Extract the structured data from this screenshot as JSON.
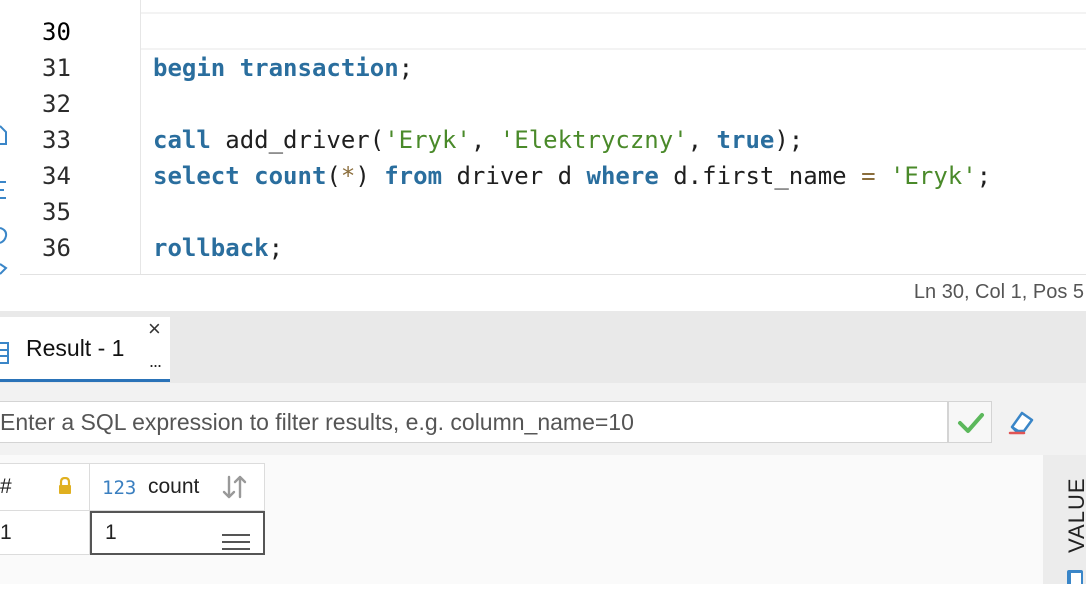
{
  "editor": {
    "lines": [
      {
        "number": "30",
        "tokens": []
      },
      {
        "number": "31",
        "tokens": [
          {
            "t": "kw",
            "v": "begin"
          },
          {
            "t": "pl",
            "v": " "
          },
          {
            "t": "kw",
            "v": "transaction"
          },
          {
            "t": "pl",
            "v": ";"
          }
        ]
      },
      {
        "number": "32",
        "tokens": []
      },
      {
        "number": "33",
        "tokens": [
          {
            "t": "kw",
            "v": "call"
          },
          {
            "t": "pl",
            "v": " add_driver("
          },
          {
            "t": "str",
            "v": "'Eryk'"
          },
          {
            "t": "pl",
            "v": ", "
          },
          {
            "t": "str",
            "v": "'Elektryczny'"
          },
          {
            "t": "pl",
            "v": ", "
          },
          {
            "t": "kw",
            "v": "true"
          },
          {
            "t": "pl",
            "v": ");"
          }
        ]
      },
      {
        "number": "34",
        "tokens": [
          {
            "t": "kw",
            "v": "select"
          },
          {
            "t": "pl",
            "v": " "
          },
          {
            "t": "kw",
            "v": "count"
          },
          {
            "t": "pl",
            "v": "("
          },
          {
            "t": "op",
            "v": "*"
          },
          {
            "t": "pl",
            "v": ") "
          },
          {
            "t": "kw",
            "v": "from"
          },
          {
            "t": "pl",
            "v": " driver d "
          },
          {
            "t": "kw",
            "v": "where"
          },
          {
            "t": "pl",
            "v": " d.first_name "
          },
          {
            "t": "op",
            "v": "="
          },
          {
            "t": "pl",
            "v": " "
          },
          {
            "t": "str",
            "v": "'Eryk'"
          },
          {
            "t": "pl",
            "v": ";"
          }
        ]
      },
      {
        "number": "35",
        "tokens": []
      },
      {
        "number": "36",
        "tokens": [
          {
            "t": "kw",
            "v": "rollback"
          },
          {
            "t": "pl",
            "v": ";"
          }
        ]
      }
    ],
    "status": "Ln 30, Col 1, Pos 5"
  },
  "results": {
    "tab": {
      "label": "Result - 1",
      "close": "×",
      "more": "..."
    },
    "filter": {
      "placeholder": "Enter a SQL expression to filter results, e.g. column_name=10",
      "value": ""
    },
    "grid": {
      "rownum_header": "#",
      "columns": [
        {
          "type_badge": "123",
          "name": "count"
        }
      ],
      "rows": [
        {
          "rownum": "1",
          "values": [
            "1"
          ]
        }
      ]
    },
    "side_panel": {
      "label": "VALUE"
    }
  },
  "icons": {
    "apply": "checkmark-icon",
    "erase": "eraser-icon",
    "lock": "lock-icon",
    "sort": "sort-icon",
    "cell_menu": "hamburger-menu-icon",
    "tab": "grid-icon"
  },
  "colors": {
    "keyword": "#2a6e9e",
    "string": "#4a8a2a",
    "operator": "#8a6d3b",
    "accent": "#2a73b8",
    "apply": "#5cb85c",
    "lock": "#e0b020"
  }
}
